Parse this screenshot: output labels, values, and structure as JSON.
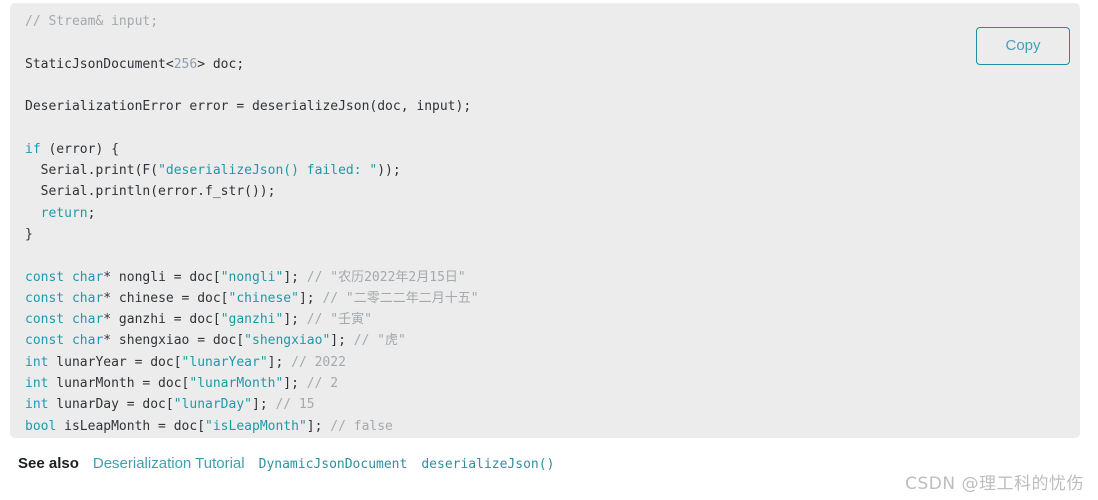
{
  "code_block": {
    "language": "cpp",
    "background_color": "#ececec",
    "copy_button_label": "Copy",
    "lines": [
      {
        "id": "line-1",
        "text": "// Stream& input;",
        "kind": "comment"
      },
      {
        "id": "line-2",
        "text": "",
        "kind": "blank"
      },
      {
        "id": "line-3",
        "text": "StaticJsonDocument<256> doc;",
        "kind": "code"
      },
      {
        "id": "line-4",
        "text": "",
        "kind": "blank"
      },
      {
        "id": "line-5",
        "text": "DeserializationError error = deserializeJson(doc, input);",
        "kind": "code"
      },
      {
        "id": "line-6",
        "text": "",
        "kind": "blank"
      },
      {
        "id": "line-7",
        "text": "if (error) {",
        "kind": "code"
      },
      {
        "id": "line-8",
        "text": "  Serial.print(F(\"deserializeJson() failed: \"));",
        "kind": "code"
      },
      {
        "id": "line-9",
        "text": "  Serial.println(error.f_str());",
        "kind": "code"
      },
      {
        "id": "line-10",
        "text": "  return;",
        "kind": "code"
      },
      {
        "id": "line-11",
        "text": "}",
        "kind": "code"
      },
      {
        "id": "line-12",
        "text": "",
        "kind": "blank"
      },
      {
        "id": "line-13",
        "text": "const char* nongli = doc[\"nongli\"]; // \"农历2022年2月15日\"",
        "kind": "code"
      },
      {
        "id": "line-14",
        "text": "const char* chinese = doc[\"chinese\"]; // \"二零二二年二月十五\"",
        "kind": "code"
      },
      {
        "id": "line-15",
        "text": "const char* ganzhi = doc[\"ganzhi\"]; // \"壬寅\"",
        "kind": "code"
      },
      {
        "id": "line-16",
        "text": "const char* shengxiao = doc[\"shengxiao\"]; // \"虎\"",
        "kind": "code"
      },
      {
        "id": "line-17",
        "text": "int lunarYear = doc[\"lunarYear\"]; // 2022",
        "kind": "code"
      },
      {
        "id": "line-18",
        "text": "int lunarMonth = doc[\"lunarMonth\"]; // 2",
        "kind": "code"
      },
      {
        "id": "line-19",
        "text": "int lunarDay = doc[\"lunarDay\"]; // 15",
        "kind": "code"
      },
      {
        "id": "line-20",
        "text": "bool isLeapMonth = doc[\"isLeapMonth\"]; // false",
        "kind": "code"
      }
    ],
    "tokens": {
      "comment_1": "// Stream& input;",
      "type_static_json_document": "StaticJsonDocument",
      "template_arg": "256",
      "var_doc": "doc",
      "type_deserialization_error": "DeserializationError",
      "fn_deserialize_json": "deserializeJson",
      "keyword_if": "if",
      "keyword_return": "return",
      "keyword_const": "const",
      "keyword_char": "char",
      "keyword_int": "int",
      "keyword_bool": "bool",
      "string_failed": "\"deserializeJson() failed: \"",
      "key_nongli": "\"nongli\"",
      "key_chinese": "\"chinese\"",
      "key_ganzhi": "\"ganzhi\"",
      "key_shengxiao": "\"shengxiao\"",
      "key_lunar_year": "\"lunarYear\"",
      "key_lunar_month": "\"lunarMonth\"",
      "key_lunar_day": "\"lunarDay\"",
      "key_is_leap_month": "\"isLeapMonth\"",
      "comment_nongli": "// \"农历2022年2月15日\"",
      "comment_chinese": "// \"二零二二年二月十五\"",
      "comment_ganzhi": "// \"壬寅\"",
      "comment_shengxiao": "// \"虎\"",
      "comment_lunar_year": "// 2022",
      "comment_lunar_month": "// 2",
      "comment_lunar_day": "// 15",
      "comment_is_leap_month": "// false"
    },
    "colors": {
      "keyword": "#1e9ab0",
      "string": "#1d9aa8",
      "number": "#8c9daf",
      "comment": "#a3a9ad",
      "plain": "#2f3337",
      "copy_border": "#1c8fa3",
      "copy_text": "#3fa3b5"
    }
  },
  "see_also": {
    "label": "See also",
    "links": [
      {
        "text": "Deserialization Tutorial",
        "mono": false
      },
      {
        "text": "DynamicJsonDocument",
        "mono": true
      },
      {
        "text": "deserializeJson()",
        "mono": true
      }
    ],
    "link_color": "#3f9fb0"
  },
  "watermark": {
    "text": "CSDN @理工科的忧伤",
    "color": "#bdbdbd"
  }
}
